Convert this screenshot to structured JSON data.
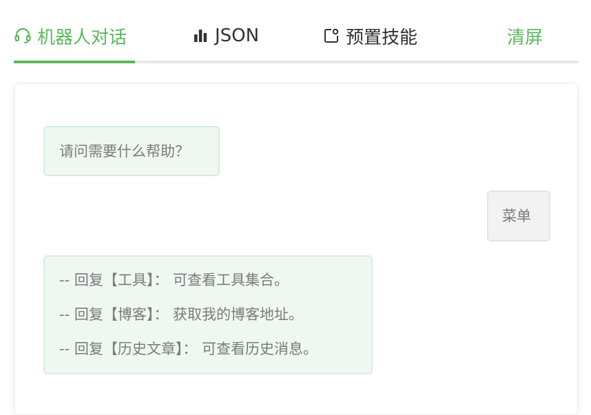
{
  "tabs": {
    "chat": {
      "label": "机器人对话",
      "icon": "headset-icon"
    },
    "json": {
      "label": "JSON",
      "icon": "bar-chart-icon"
    },
    "skills": {
      "label": "预置技能",
      "icon": "preset-skill-icon"
    },
    "clear": {
      "label": "清屏"
    }
  },
  "colors": {
    "accent": "#5cb85c",
    "bot_bubble": "#eef8f1",
    "user_bubble": "#f2f2f2"
  },
  "messages": {
    "greeting": "请问需要什么帮助？",
    "user_menu": "菜单",
    "menu_lines": [
      "-- 回复【工具】：  可查看工具集合。",
      "-- 回复【博客】：  获取我的博客地址。",
      "-- 回复【历史文章】：  可查看历史消息。"
    ]
  }
}
